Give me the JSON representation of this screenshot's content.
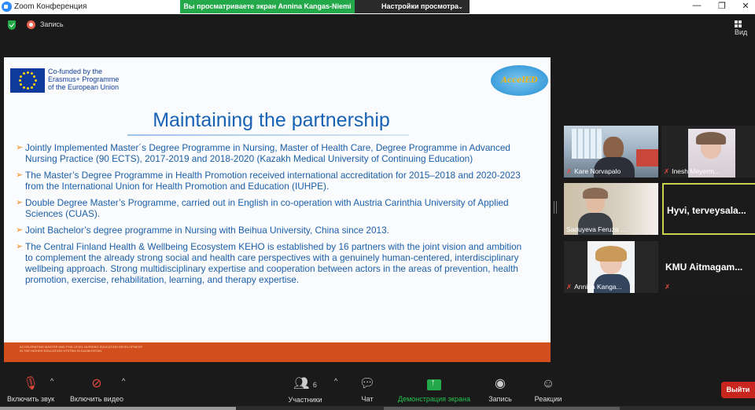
{
  "window": {
    "title": "Zoom Конференция",
    "viewing_banner": "Вы просматриваете экран Annina Kangas-Niemi",
    "view_options": "Настройки просмотра",
    "minimize": "—",
    "restore": "❐",
    "close": "✕"
  },
  "info_bar": {
    "recording_label": "Запись",
    "view_label": "Вид"
  },
  "slide": {
    "eu_text_1": "Co-funded by the",
    "eu_text_2": "Erasmus+ Programme",
    "eu_text_3": "of the European Union",
    "project_logo": "AccelED",
    "title": "Maintaining the partnership",
    "bullets": [
      "Jointly Implemented Master´s Degree Programme in Nursing, Master of Health Care, Degree Programme in Advanced Nursing Practice (90 ECTS), 2017-2019 and 2018-2020 (Kazakh Medical University of Continuing Education)",
      "The Master’s Degree Programme in Health Promotion received international accreditation for 2015–2018 and 2020-2023 from the International Union for Health Promotion and Education (IUHPE).",
      "Double Degree Master’s Programme, carried out in English in co-operation with Austria Carinthia University of Applied Sciences (CUAS).",
      "Joint Bachelor’s degree programme in Nursing with Beihua University, China since 2013.",
      "The Central Finland Health & Wellbeing Ecosystem KEHO is established by 16 partners with the joint vision and ambition to complement the already strong social and health care perspectives with a genuinely human-centered, interdisciplinary wellbeing approach.  Strong multidisciplinary expertise and cooperation between actors in the areas of prevention, health promotion, exercise, rehabilitation, learning, and therapy expertise."
    ],
    "footer_text": "ACCELERATING MASTER AND PHD LEVEL NURSING EDUCATION DEVELOPMENT IN THE HIGHER EDUCATION SYSTEM IN KAZAKHSTAN"
  },
  "participants": [
    {
      "name": "Kare Norvapalo"
    },
    {
      "name": "Inesh Meyerm..."
    },
    {
      "name": "Saduyeva Feruza ..."
    },
    {
      "name": "Hyvi,  terveysala..."
    },
    {
      "name": "Annina Kanga..."
    },
    {
      "name": "KMU  Aitmagam..."
    }
  ],
  "toolbar": {
    "mute_label": "Включить звук",
    "video_label": "Включить видео",
    "participants_label": "Участники",
    "participants_count": "6",
    "chat_label": "Чат",
    "share_label": "Демонстрация экрана",
    "record_label": "Запись",
    "reactions_label": "Реакции",
    "leave_label": "Выйти"
  },
  "colors": {
    "banner_green": "#23a94a",
    "slide_title": "#1762b4",
    "bullet_arrow": "#f08a1a",
    "footer_orange": "#d24f1d",
    "leave_red": "#c7251d"
  }
}
